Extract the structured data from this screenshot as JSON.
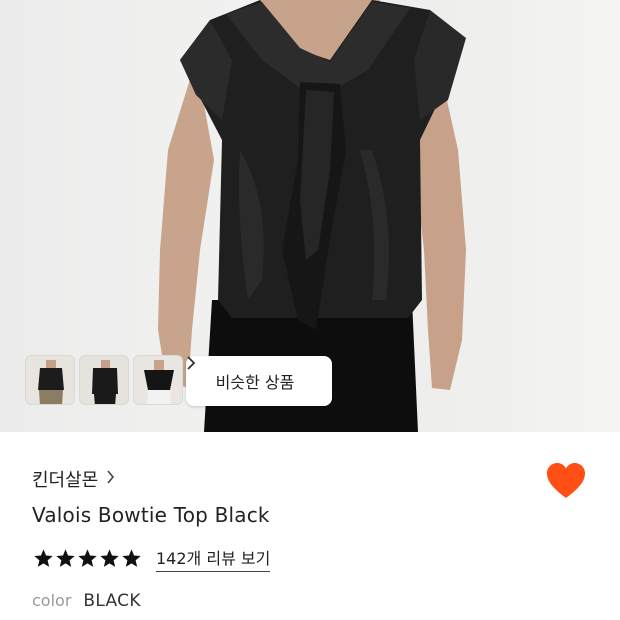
{
  "product": {
    "brand": "킨더살몬",
    "name": "Valois Bowtie Top Black",
    "rating_stars": 5,
    "reviews_link": "142개 리뷰 보기",
    "color_label": "color",
    "color_value": "BLACK",
    "favorited": true
  },
  "gallery": {
    "similar_button": "비슷한 상품"
  },
  "icons": {
    "brand_chevron": "chevron-right-icon",
    "similar_chevron": "chevron-right-icon",
    "favorite": "heart-icon",
    "star": "star-icon"
  },
  "colors": {
    "heart": "#ff4f14",
    "star": "#111111"
  }
}
